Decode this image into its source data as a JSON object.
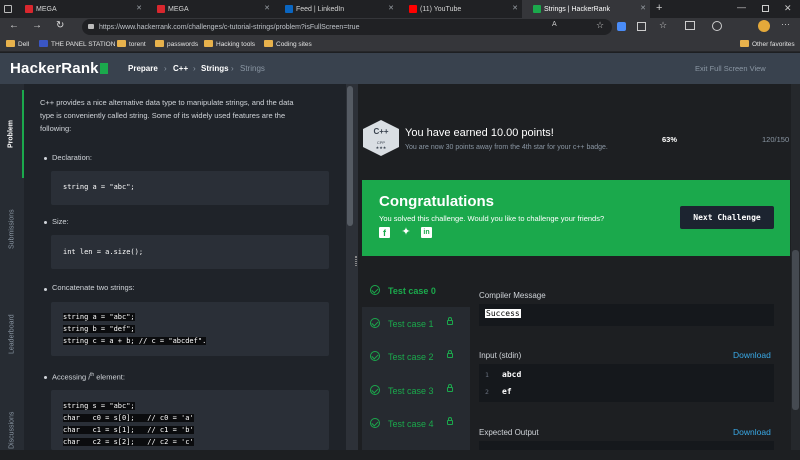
{
  "browser": {
    "tabs": [
      {
        "title": "MEGA"
      },
      {
        "title": "MEGA"
      },
      {
        "title": "Feed | LinkedIn"
      },
      {
        "title": "(11) YouTube"
      },
      {
        "title": "Strings | HackerRank"
      }
    ],
    "url": "https://www.hackerrank.com/challenges/c-tutorial-strings/problem?isFullScreen=true",
    "bookmarks": [
      "Dell",
      "THE PANEL STATION",
      "torent",
      "passwords",
      "Hacking tools",
      "Coding sites"
    ],
    "other_favorites": "Other favorites"
  },
  "header": {
    "logo": "HackerRank",
    "breadcrumb": [
      "Prepare",
      "C++",
      "Strings",
      "Strings"
    ],
    "exit_fullscreen": "Exit Full Screen View"
  },
  "leftnav": {
    "items": [
      "Problem",
      "Submissions",
      "Leaderboard",
      "Discussions"
    ]
  },
  "problem": {
    "intro_line1": "C++ provides a nice alternative data type to manipulate strings, and the data",
    "intro_line2": "type is conveniently called string. Some of its widely used features are the",
    "intro_line3": "following:",
    "declaration_label": "Declaration:",
    "declaration_code": "string a = \"abc\";",
    "size_label": "Size:",
    "size_code": "int len = a.size();",
    "concat_label": "Concatenate two strings:",
    "concat_code": [
      "string a = \"abc\";",
      "string b = \"def\";",
      "string c = a + b; // c = \"abcdef\"."
    ],
    "access_label_pre": "Accessing ",
    "access_label_sup": "i",
    "access_label_sup2": "th",
    "access_label_post": " element:",
    "access_code": [
      "string s = \"abc\";",
      "char   c0 = s[0];   // c0 = 'a'",
      "char   c1 = s[1];   // c1 = 'b'",
      "char   c2 = s[2];   // c2 = 'c'"
    ]
  },
  "result": {
    "badge_title": "C++",
    "badge_sub": "CPP",
    "badge_stars": "★★★",
    "earned": "You have earned 10.00 points!",
    "progress_text": "You are now 30 points away from the 4th star for your c++ badge.",
    "progress_percent": "63%",
    "progress_value": 0.63,
    "score": "120/150",
    "congrats_title": "Congratulations",
    "congrats_sub": "You solved this challenge. Would you like to challenge your friends?",
    "next_button": "Next Challenge"
  },
  "testcases": {
    "items": [
      "Test case 0",
      "Test case 1",
      "Test case 2",
      "Test case 3",
      "Test case 4"
    ],
    "compiler_label": "Compiler Message",
    "compiler_message": "Success",
    "input_label": "Input (stdin)",
    "download": "Download",
    "input_lines": [
      {
        "num": "1",
        "text": "abcd"
      },
      {
        "num": "2",
        "text": "ef"
      }
    ],
    "expected_label": "Expected Output"
  }
}
